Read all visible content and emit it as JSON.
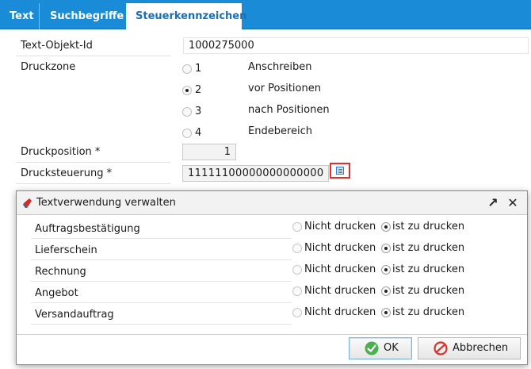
{
  "tabs": [
    {
      "label": "Text"
    },
    {
      "label": "Suchbegriffe"
    },
    {
      "label": "Steuerkennzeichen"
    }
  ],
  "form": {
    "textobjekt_label": "Text-Objekt-Id",
    "textobjekt_value": "1000275000",
    "druckzone_label": "Druckzone",
    "druckzone_options": [
      {
        "num": "1",
        "text": "Anschreiben",
        "selected": false
      },
      {
        "num": "2",
        "text": "vor Positionen",
        "selected": true
      },
      {
        "num": "3",
        "text": "nach Positionen",
        "selected": false
      },
      {
        "num": "4",
        "text": "Endebereich",
        "selected": false
      }
    ],
    "druckposition_label": "Druckposition *",
    "druckposition_value": "1",
    "drucksteuerung_label": "Drucksteuerung *",
    "drucksteuerung_value": "11111100000000000000"
  },
  "dialog": {
    "title": "Textverwendung verwalten",
    "option_no": "Nicht drucken",
    "option_yes": "ist zu drucken",
    "rows": [
      {
        "label": "Auftragsbestätigung",
        "value": "ist zu drucken"
      },
      {
        "label": "Lieferschein",
        "value": "ist zu drucken"
      },
      {
        "label": "Rechnung",
        "value": "ist zu drucken"
      },
      {
        "label": "Angebot",
        "value": "ist zu drucken"
      },
      {
        "label": "Versandauftrag",
        "value": "ist zu drucken"
      }
    ],
    "ok_label": "OK",
    "cancel_label": "Abbrechen",
    "expand_icon": "↗",
    "close_icon": "✕"
  },
  "colors": {
    "tabbar": "#1a8bd6",
    "active_tab_text": "#1a6fb5",
    "highlight_border": "#e0302b"
  }
}
